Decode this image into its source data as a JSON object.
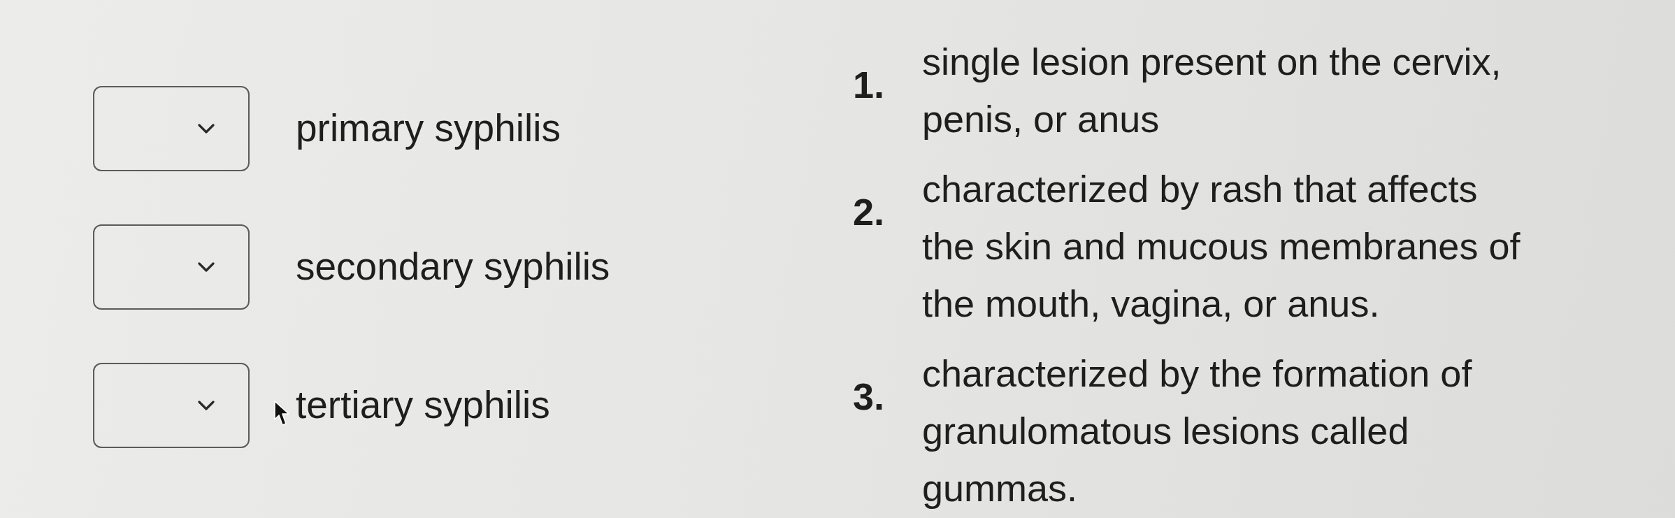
{
  "matching": {
    "terms": [
      {
        "term": "primary syphilis",
        "mouse_pointer": false
      },
      {
        "term": "secondary syphilis",
        "mouse_pointer": false
      },
      {
        "term": "tertiary syphilis",
        "mouse_pointer": true
      }
    ],
    "descriptions": [
      {
        "number": "1.",
        "text": "single lesion present on the cervix, penis, or anus"
      },
      {
        "number": "2.",
        "text": "characterized by rash that affects the skin and mucous membranes of the mouth, vagina, or anus."
      },
      {
        "number": "3.",
        "text": "characterized by the formation of granulomatous lesions called gummas."
      }
    ]
  }
}
